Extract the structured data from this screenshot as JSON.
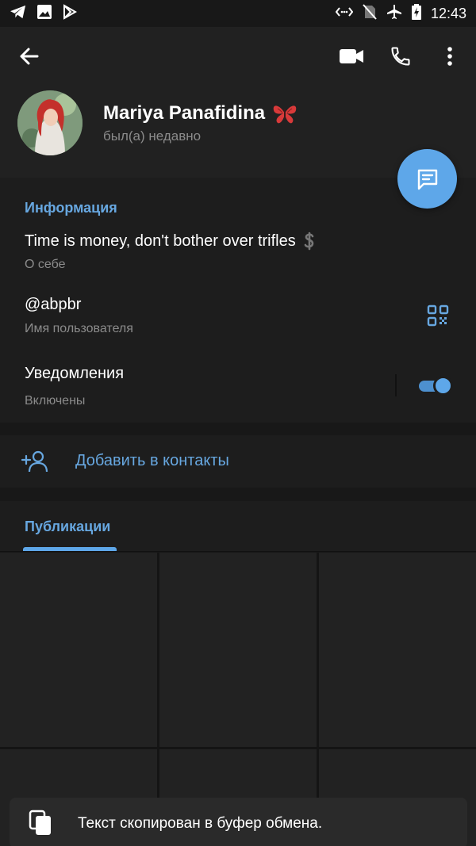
{
  "status_bar": {
    "time": "12:43",
    "left_icons": [
      "telegram-icon",
      "gallery-icon",
      "play-store-icon"
    ],
    "right_icons": [
      "data-saver-icon",
      "no-sim-icon",
      "airplane-mode-icon",
      "battery-charging-icon"
    ]
  },
  "header": {
    "back_icon": "arrow-left-icon",
    "actions": [
      "video-call-icon",
      "phone-icon",
      "more-vertical-icon"
    ],
    "profile": {
      "name": "Mariya Panafidina",
      "emoji_icon": "butterfly-emoji",
      "status": "был(а) недавно"
    },
    "fab_icon": "message-icon"
  },
  "info": {
    "section_title": "Информация",
    "bio": "Time is money, don't bother over trifles",
    "bio_icon": "dollar-icon",
    "bio_label": "О себе",
    "username": "@abpbr",
    "username_label": "Имя пользователя",
    "qr_icon": "qr-code-icon",
    "notifications": "Уведомления",
    "notifications_state": "Включены",
    "notifications_on": true
  },
  "add_contact": {
    "label": "Добавить в контакты",
    "icon": "add-user-icon"
  },
  "tabs": {
    "active": "Публикации"
  },
  "toast": {
    "text": "Текст скопирован в буфер обмена.",
    "icon": "copy-icon"
  },
  "colors": {
    "accent": "#5ea7e9",
    "accent_text": "#67a7e0",
    "background": "#181818",
    "surface": "#1d1d1d",
    "secondary_text": "#8b8b8b"
  }
}
